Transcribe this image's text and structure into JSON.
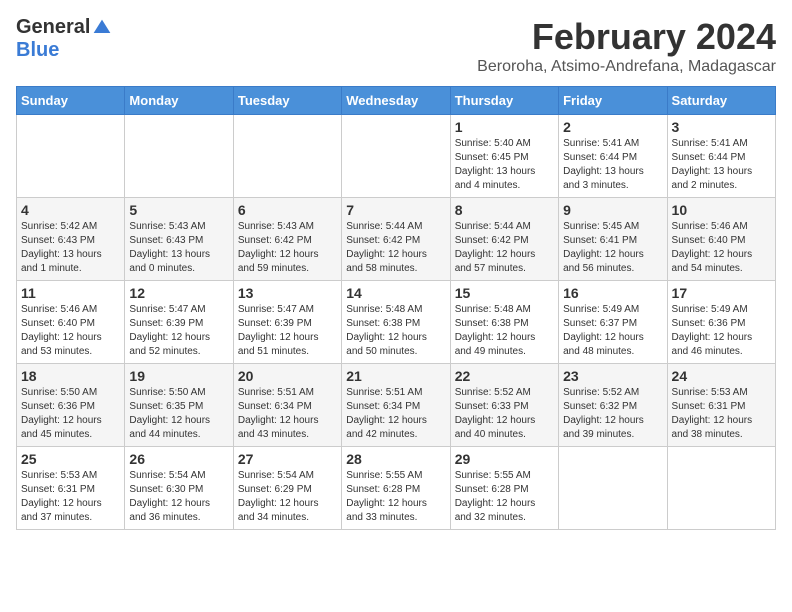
{
  "logo": {
    "general": "General",
    "blue": "Blue"
  },
  "title": "February 2024",
  "subtitle": "Beroroha, Atsimo-Andrefana, Madagascar",
  "weekdays": [
    "Sunday",
    "Monday",
    "Tuesday",
    "Wednesday",
    "Thursday",
    "Friday",
    "Saturday"
  ],
  "weeks": [
    [
      {
        "day": "",
        "info": ""
      },
      {
        "day": "",
        "info": ""
      },
      {
        "day": "",
        "info": ""
      },
      {
        "day": "",
        "info": ""
      },
      {
        "day": "1",
        "info": "Sunrise: 5:40 AM\nSunset: 6:45 PM\nDaylight: 13 hours and 4 minutes."
      },
      {
        "day": "2",
        "info": "Sunrise: 5:41 AM\nSunset: 6:44 PM\nDaylight: 13 hours and 3 minutes."
      },
      {
        "day": "3",
        "info": "Sunrise: 5:41 AM\nSunset: 6:44 PM\nDaylight: 13 hours and 2 minutes."
      }
    ],
    [
      {
        "day": "4",
        "info": "Sunrise: 5:42 AM\nSunset: 6:43 PM\nDaylight: 13 hours and 1 minute."
      },
      {
        "day": "5",
        "info": "Sunrise: 5:43 AM\nSunset: 6:43 PM\nDaylight: 13 hours and 0 minutes."
      },
      {
        "day": "6",
        "info": "Sunrise: 5:43 AM\nSunset: 6:42 PM\nDaylight: 12 hours and 59 minutes."
      },
      {
        "day": "7",
        "info": "Sunrise: 5:44 AM\nSunset: 6:42 PM\nDaylight: 12 hours and 58 minutes."
      },
      {
        "day": "8",
        "info": "Sunrise: 5:44 AM\nSunset: 6:42 PM\nDaylight: 12 hours and 57 minutes."
      },
      {
        "day": "9",
        "info": "Sunrise: 5:45 AM\nSunset: 6:41 PM\nDaylight: 12 hours and 56 minutes."
      },
      {
        "day": "10",
        "info": "Sunrise: 5:46 AM\nSunset: 6:40 PM\nDaylight: 12 hours and 54 minutes."
      }
    ],
    [
      {
        "day": "11",
        "info": "Sunrise: 5:46 AM\nSunset: 6:40 PM\nDaylight: 12 hours and 53 minutes."
      },
      {
        "day": "12",
        "info": "Sunrise: 5:47 AM\nSunset: 6:39 PM\nDaylight: 12 hours and 52 minutes."
      },
      {
        "day": "13",
        "info": "Sunrise: 5:47 AM\nSunset: 6:39 PM\nDaylight: 12 hours and 51 minutes."
      },
      {
        "day": "14",
        "info": "Sunrise: 5:48 AM\nSunset: 6:38 PM\nDaylight: 12 hours and 50 minutes."
      },
      {
        "day": "15",
        "info": "Sunrise: 5:48 AM\nSunset: 6:38 PM\nDaylight: 12 hours and 49 minutes."
      },
      {
        "day": "16",
        "info": "Sunrise: 5:49 AM\nSunset: 6:37 PM\nDaylight: 12 hours and 48 minutes."
      },
      {
        "day": "17",
        "info": "Sunrise: 5:49 AM\nSunset: 6:36 PM\nDaylight: 12 hours and 46 minutes."
      }
    ],
    [
      {
        "day": "18",
        "info": "Sunrise: 5:50 AM\nSunset: 6:36 PM\nDaylight: 12 hours and 45 minutes."
      },
      {
        "day": "19",
        "info": "Sunrise: 5:50 AM\nSunset: 6:35 PM\nDaylight: 12 hours and 44 minutes."
      },
      {
        "day": "20",
        "info": "Sunrise: 5:51 AM\nSunset: 6:34 PM\nDaylight: 12 hours and 43 minutes."
      },
      {
        "day": "21",
        "info": "Sunrise: 5:51 AM\nSunset: 6:34 PM\nDaylight: 12 hours and 42 minutes."
      },
      {
        "day": "22",
        "info": "Sunrise: 5:52 AM\nSunset: 6:33 PM\nDaylight: 12 hours and 40 minutes."
      },
      {
        "day": "23",
        "info": "Sunrise: 5:52 AM\nSunset: 6:32 PM\nDaylight: 12 hours and 39 minutes."
      },
      {
        "day": "24",
        "info": "Sunrise: 5:53 AM\nSunset: 6:31 PM\nDaylight: 12 hours and 38 minutes."
      }
    ],
    [
      {
        "day": "25",
        "info": "Sunrise: 5:53 AM\nSunset: 6:31 PM\nDaylight: 12 hours and 37 minutes."
      },
      {
        "day": "26",
        "info": "Sunrise: 5:54 AM\nSunset: 6:30 PM\nDaylight: 12 hours and 36 minutes."
      },
      {
        "day": "27",
        "info": "Sunrise: 5:54 AM\nSunset: 6:29 PM\nDaylight: 12 hours and 34 minutes."
      },
      {
        "day": "28",
        "info": "Sunrise: 5:55 AM\nSunset: 6:28 PM\nDaylight: 12 hours and 33 minutes."
      },
      {
        "day": "29",
        "info": "Sunrise: 5:55 AM\nSunset: 6:28 PM\nDaylight: 12 hours and 32 minutes."
      },
      {
        "day": "",
        "info": ""
      },
      {
        "day": "",
        "info": ""
      }
    ]
  ]
}
